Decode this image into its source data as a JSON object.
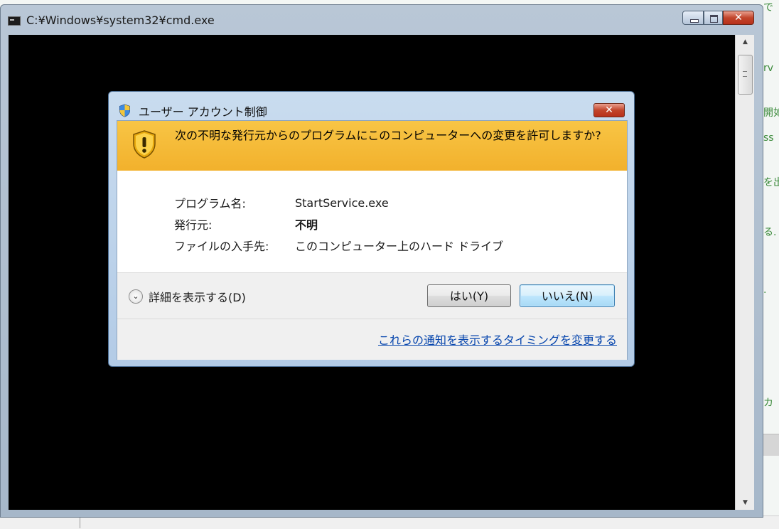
{
  "background": {
    "edge_chars": [
      "で",
      "rv",
      "開如",
      "ss",
      "を出",
      "る.",
      ".",
      "カ"
    ]
  },
  "console": {
    "title": "C:¥Windows¥system32¥cmd.exe",
    "close_glyph": "✕"
  },
  "uac": {
    "title": "ユーザー アカウント制御",
    "close_glyph": "✕",
    "question": "次の不明な発行元からのプログラムにこのコンピューターへの変更を許可しますか?",
    "info": [
      {
        "key": "プログラム名:",
        "value": "StartService.exe"
      },
      {
        "key": "発行元:",
        "value": "不明"
      },
      {
        "key": "ファイルの入手先:",
        "value": "このコンピューター上のハード ドライブ"
      }
    ],
    "details_label": "詳細を表示する(D)",
    "yes_label": "はい(Y)",
    "no_label": "いいえ(N)",
    "notify_link": "これらの通知を表示するタイミングを変更する",
    "colors": {
      "banner": "#f4b933",
      "link": "#0645ad",
      "default_button_border": "#3c7fb1"
    }
  }
}
